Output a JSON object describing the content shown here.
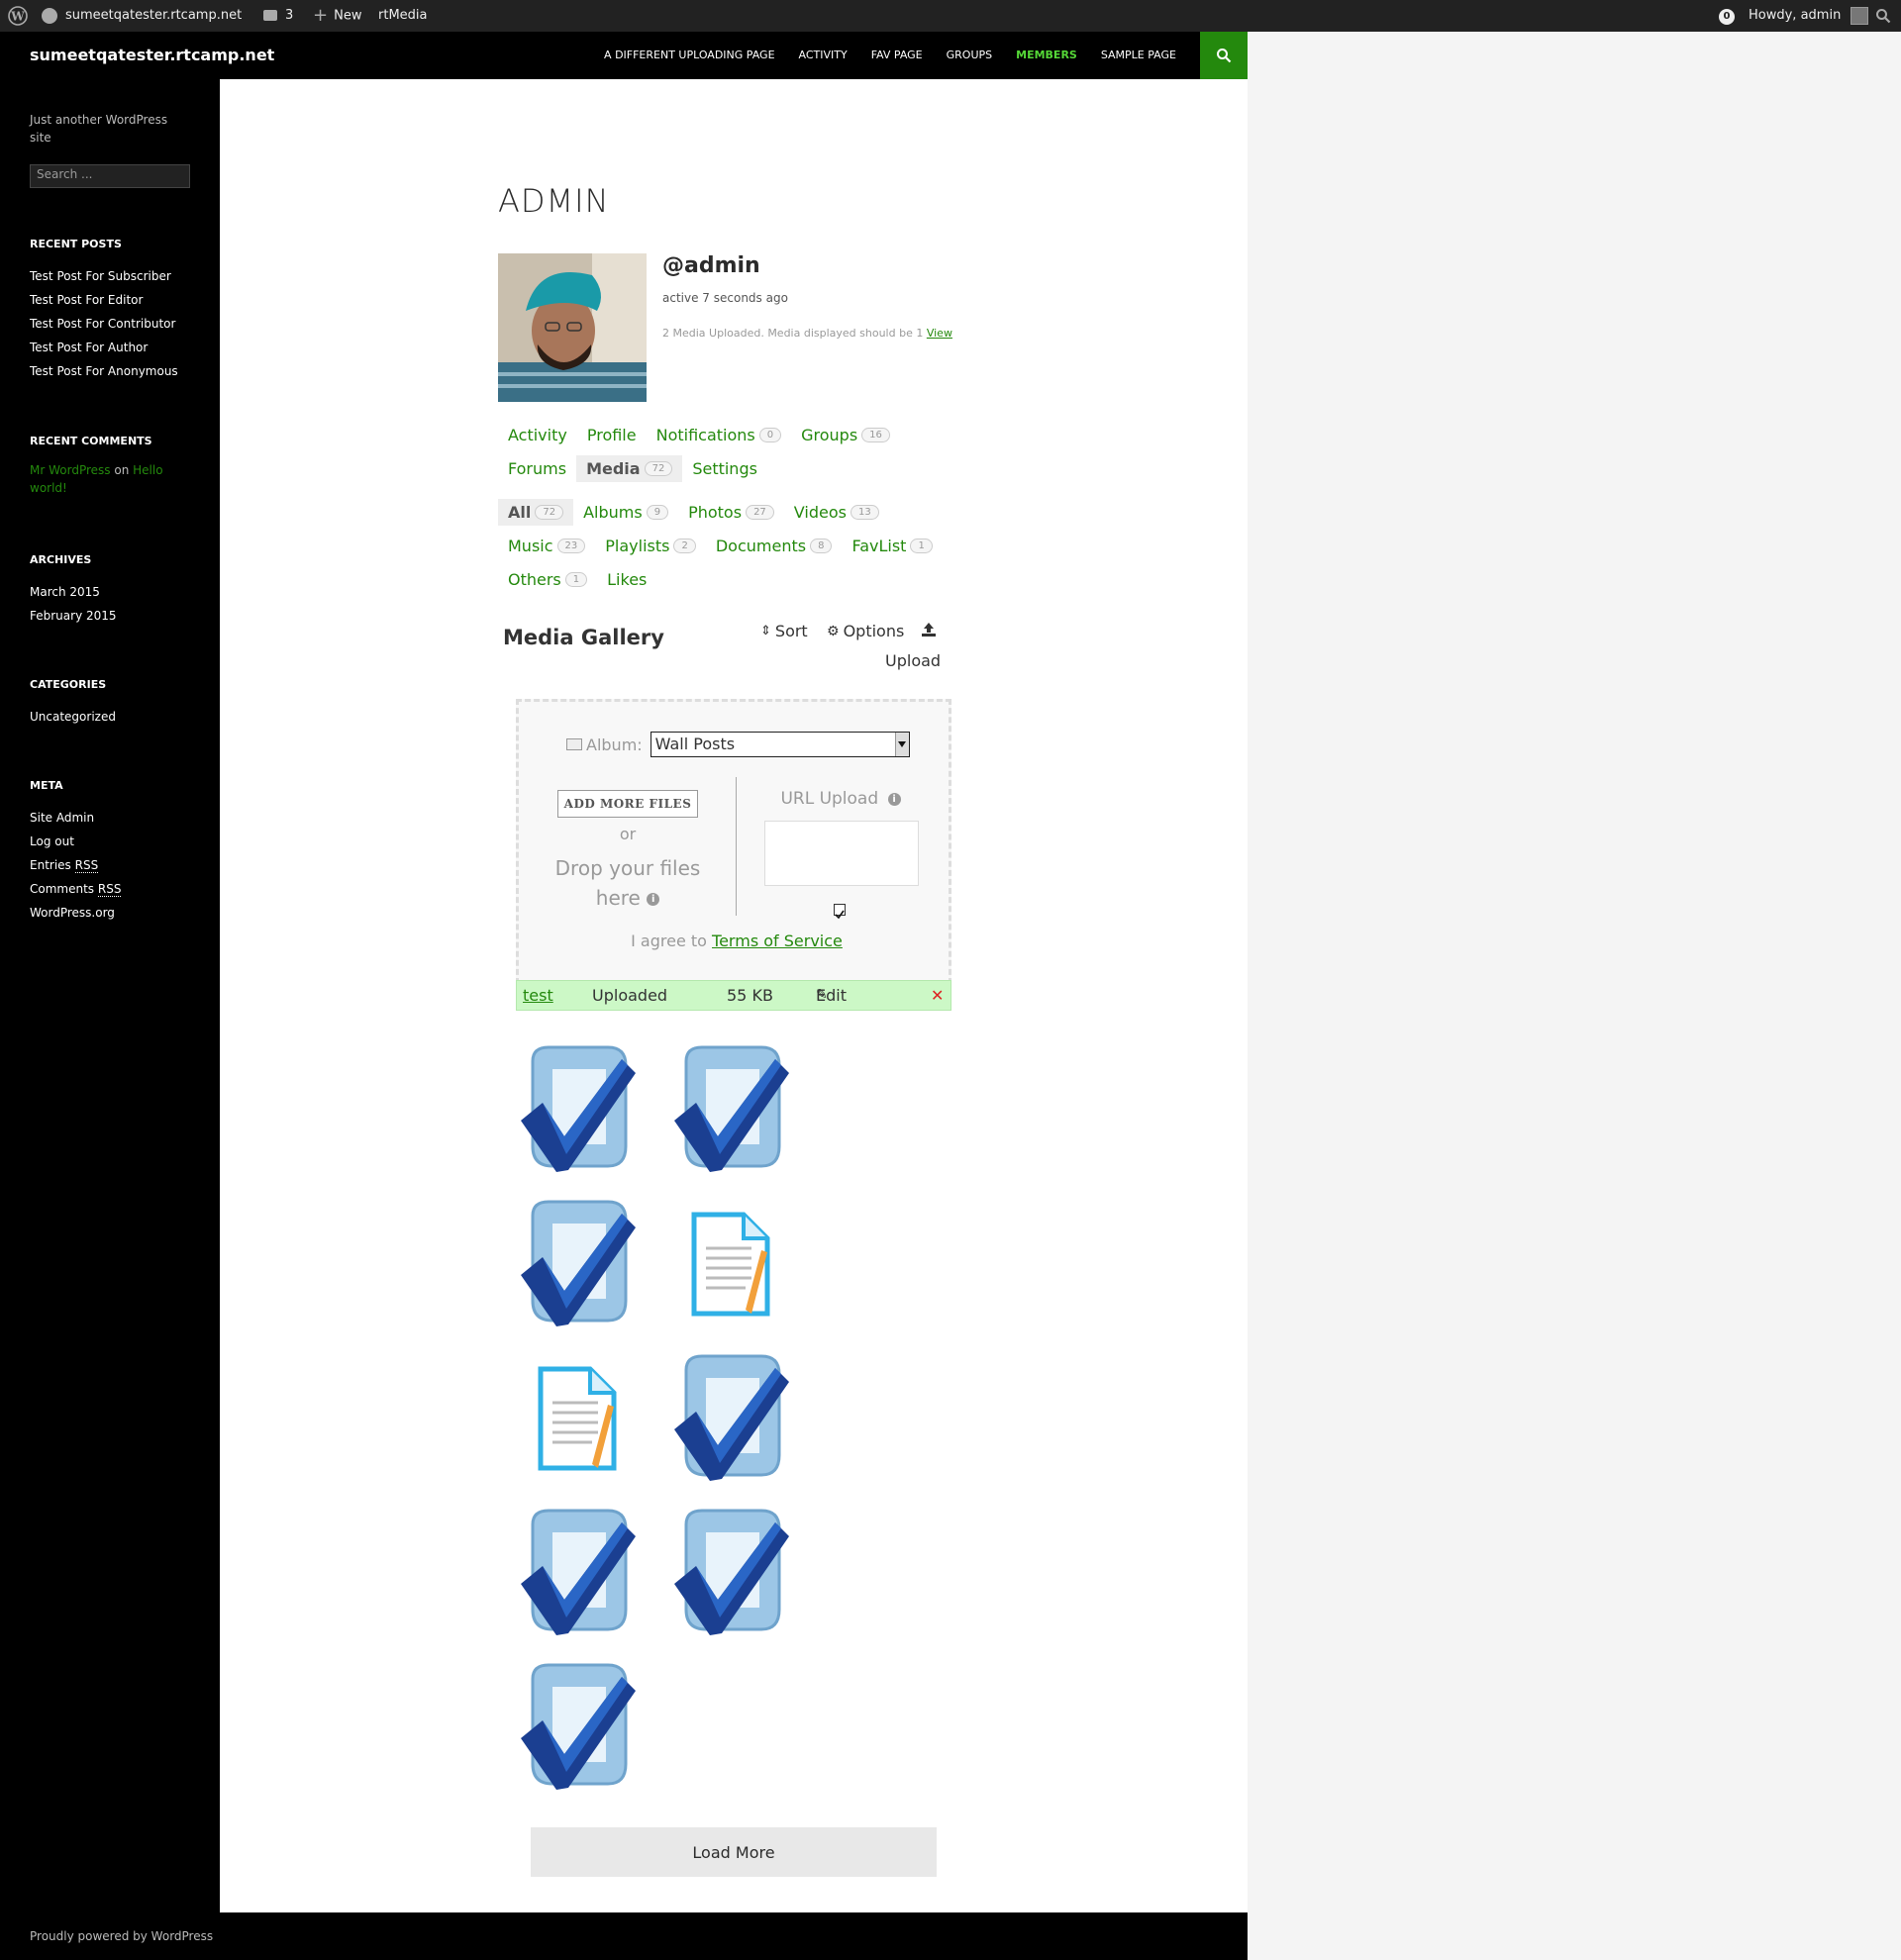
{
  "adminbar": {
    "site": "sumeetqatester.rtcamp.net",
    "comments_count": "3",
    "new_label": "New",
    "plugin_label": "rtMedia",
    "notif_count": "0",
    "howdy": "Howdy, admin"
  },
  "header": {
    "site_title": "sumeetqatester.rtcamp.net",
    "nav": [
      "A DIFFERENT UPLOADING PAGE",
      "ACTIVITY",
      "FAV PAGE",
      "GROUPS",
      "MEMBERS",
      "SAMPLE PAGE"
    ],
    "active_nav": "MEMBERS"
  },
  "sidebar": {
    "tagline": "Just another WordPress site",
    "search_placeholder": "Search ...",
    "recent_posts_title": "RECENT POSTS",
    "recent_posts": [
      "Test Post For Subscriber",
      "Test Post For Editor",
      "Test Post For Contributor",
      "Test Post For Author",
      "Test Post For Anonymous"
    ],
    "recent_comments_title": "RECENT COMMENTS",
    "comment_author": "Mr WordPress",
    "comment_on": "on",
    "comment_post": "Hello world!",
    "archives_title": "ARCHIVES",
    "archives": [
      "March 2015",
      "February 2015"
    ],
    "categories_title": "CATEGORIES",
    "categories": [
      "Uncategorized"
    ],
    "meta_title": "META",
    "meta_site_admin": "Site Admin",
    "meta_logout": "Log out",
    "meta_entries": "Entries",
    "meta_comments": "Comments",
    "meta_rss": "RSS",
    "meta_wporg": "WordPress.org"
  },
  "profile": {
    "title": "ADMIN",
    "username": "@admin",
    "active": "active 7 seconds ago",
    "media_note": "2 Media Uploaded. Media displayed should be 1",
    "view_link": "View"
  },
  "tabs": {
    "activity": "Activity",
    "profile": "Profile",
    "notifications": "Notifications",
    "notifications_count": "0",
    "groups": "Groups",
    "groups_count": "16",
    "forums": "Forums",
    "media": "Media",
    "media_count": "72",
    "settings": "Settings"
  },
  "subtabs": {
    "all": "All",
    "all_count": "72",
    "albums": "Albums",
    "albums_count": "9",
    "photos": "Photos",
    "photos_count": "27",
    "videos": "Videos",
    "videos_count": "13",
    "music": "Music",
    "music_count": "23",
    "playlists": "Playlists",
    "playlists_count": "2",
    "documents": "Documents",
    "documents_count": "8",
    "favlist": "FavList",
    "favlist_count": "1",
    "others": "Others",
    "others_count": "1",
    "likes": "Likes"
  },
  "gallery": {
    "title": "Media Gallery",
    "sort": "Sort",
    "options": "Options",
    "upload": "Upload",
    "album_label": "Album:",
    "album_value": "Wall Posts",
    "add_files": "ADD MORE FILES",
    "or": "or",
    "drop_text": "Drop your files here",
    "url_upload": "URL Upload",
    "tos_prefix": "I agree to",
    "tos_link": "Terms of Service",
    "file_name": "test",
    "file_status": "Uploaded",
    "file_size": "55 KB",
    "file_edit": "Edit",
    "load_more": "Load More",
    "thumbs": [
      "check",
      "check",
      "check",
      "document",
      "document",
      "check",
      "check",
      "check",
      "check"
    ]
  },
  "footer": {
    "text": "Proudly powered by WordPress"
  },
  "colors": {
    "accent": "#24890d",
    "active_nav": "#55d737",
    "file_row": "#ccf8c6"
  }
}
